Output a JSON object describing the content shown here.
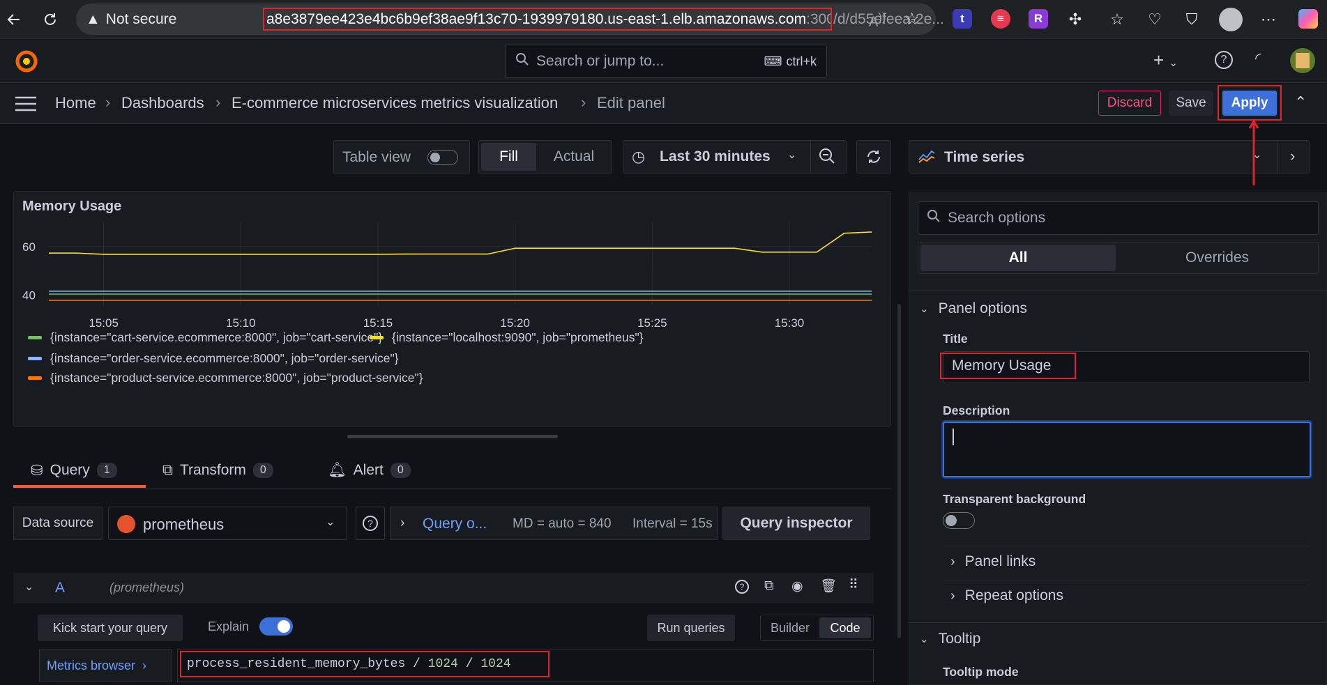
{
  "browser": {
    "not_secure": "Not secure",
    "url_highlight": "a8e3879ee423e4bc6b9ef38ae9f13c70-1939979180.us-east-1.elb.amazonaws.com",
    "url_port": ":3000",
    "url_rest": "/d/d55efeea-2e..."
  },
  "topnav": {
    "search_placeholder": "Search or jump to...",
    "shortcut": "ctrl+k"
  },
  "breadcrumb": {
    "items": [
      "Home",
      "Dashboards",
      "E-commerce microservices metrics visualization",
      "Edit panel"
    ],
    "discard": "Discard",
    "save": "Save",
    "apply": "Apply"
  },
  "toolbar": {
    "table_view": "Table view",
    "fill": "Fill",
    "actual": "Actual",
    "time_range": "Last 30 minutes"
  },
  "chart_data": {
    "type": "line",
    "title": "Memory Usage",
    "x": [
      "15:03",
      "15:04",
      "15:05",
      "15:06",
      "15:07",
      "15:08",
      "15:09",
      "15:10",
      "15:11",
      "15:12",
      "15:13",
      "15:14",
      "15:15",
      "15:16",
      "15:17",
      "15:18",
      "15:19",
      "15:20",
      "15:21",
      "15:22",
      "15:23",
      "15:24",
      "15:25",
      "15:26",
      "15:27",
      "15:28",
      "15:29",
      "15:30",
      "15:31",
      "15:32",
      "15:33"
    ],
    "xticks": [
      "15:05",
      "15:10",
      "15:15",
      "15:20",
      "15:25",
      "15:30"
    ],
    "yticks": [
      40,
      60
    ],
    "ylim": [
      35.5,
      70
    ],
    "series": [
      {
        "name": "{instance=\"localhost:9090\", job=\"prometheus\"}",
        "color": "#fade2a",
        "values": [
          57.3,
          57.3,
          56.8,
          56.8,
          56.8,
          56.8,
          56.8,
          56.8,
          56.8,
          56.8,
          56.8,
          56.8,
          56.8,
          56.9,
          56.9,
          56.9,
          56.9,
          59.3,
          59.3,
          59.3,
          59.3,
          59.3,
          59.3,
          59.3,
          59.3,
          59.3,
          57.7,
          57.7,
          57.7,
          65.5,
          66.0
        ]
      },
      {
        "name": "{instance=\"cart-service.ecommerce:8000\", job=\"cart-service\"}",
        "color": "#73bf69",
        "values": [
          40.4,
          40.4,
          40.4,
          40.4,
          40.4,
          40.4,
          40.4,
          40.4,
          40.4,
          40.4,
          40.4,
          40.4,
          40.4,
          40.4,
          40.4,
          40.4,
          40.4,
          40.4,
          40.4,
          40.4,
          40.4,
          40.4,
          40.4,
          40.4,
          40.4,
          40.4,
          40.4,
          40.4,
          40.4,
          40.4,
          40.4
        ]
      },
      {
        "name": "{instance=\"order-service.ecommerce:8000\", job=\"order-service\"}",
        "color": "#8ab8ff",
        "values": [
          41.6,
          41.6,
          41.6,
          41.6,
          41.6,
          41.6,
          41.6,
          41.6,
          41.6,
          41.6,
          41.6,
          41.6,
          41.6,
          41.6,
          41.6,
          41.6,
          41.6,
          41.6,
          41.6,
          41.6,
          41.6,
          41.6,
          41.6,
          41.6,
          41.6,
          41.6,
          41.6,
          41.6,
          41.6,
          41.6,
          41.6
        ]
      },
      {
        "name": "{instance=\"product-service.ecommerce:8000\", job=\"product-service\"}",
        "color": "#ff780a",
        "values": [
          37.8,
          37.8,
          37.8,
          37.8,
          37.8,
          37.8,
          37.8,
          37.8,
          37.8,
          37.8,
          37.8,
          37.8,
          37.8,
          37.8,
          37.8,
          37.8,
          37.8,
          37.8,
          37.8,
          37.8,
          37.8,
          37.8,
          37.8,
          37.8,
          37.8,
          37.8,
          37.8,
          37.8,
          37.8,
          37.8,
          37.8
        ]
      }
    ]
  },
  "query_tabs": [
    {
      "label": "Query",
      "count": "1"
    },
    {
      "label": "Transform",
      "count": "0"
    },
    {
      "label": "Alert",
      "count": "0"
    }
  ],
  "datasource": {
    "label": "Data source",
    "value": "prometheus",
    "query_options": "Query o...",
    "md": "MD = auto = 840",
    "interval": "Interval = 15s",
    "inspector": "Query inspector"
  },
  "query": {
    "ref": "A",
    "ds_hint": "(prometheus)",
    "kick_start": "Kick start your query",
    "explain": "Explain",
    "run": "Run queries",
    "builder": "Builder",
    "code": "Code",
    "metrics_browser": "Metrics browser",
    "expr_metric": "process_resident_memory_bytes",
    "expr_op1": "/",
    "expr_num1": "1024",
    "expr_op2": "/",
    "expr_num2": "1024"
  },
  "options": {
    "viz": "Time series",
    "search_placeholder": "Search options",
    "all": "All",
    "overrides": "Overrides",
    "panel_options": "Panel options",
    "title_label": "Title",
    "title_value": "Memory Usage",
    "description_label": "Description",
    "transparent": "Transparent background",
    "panel_links": "Panel links",
    "repeat_options": "Repeat options",
    "tooltip": "Tooltip",
    "tooltip_mode": "Tooltip mode"
  }
}
